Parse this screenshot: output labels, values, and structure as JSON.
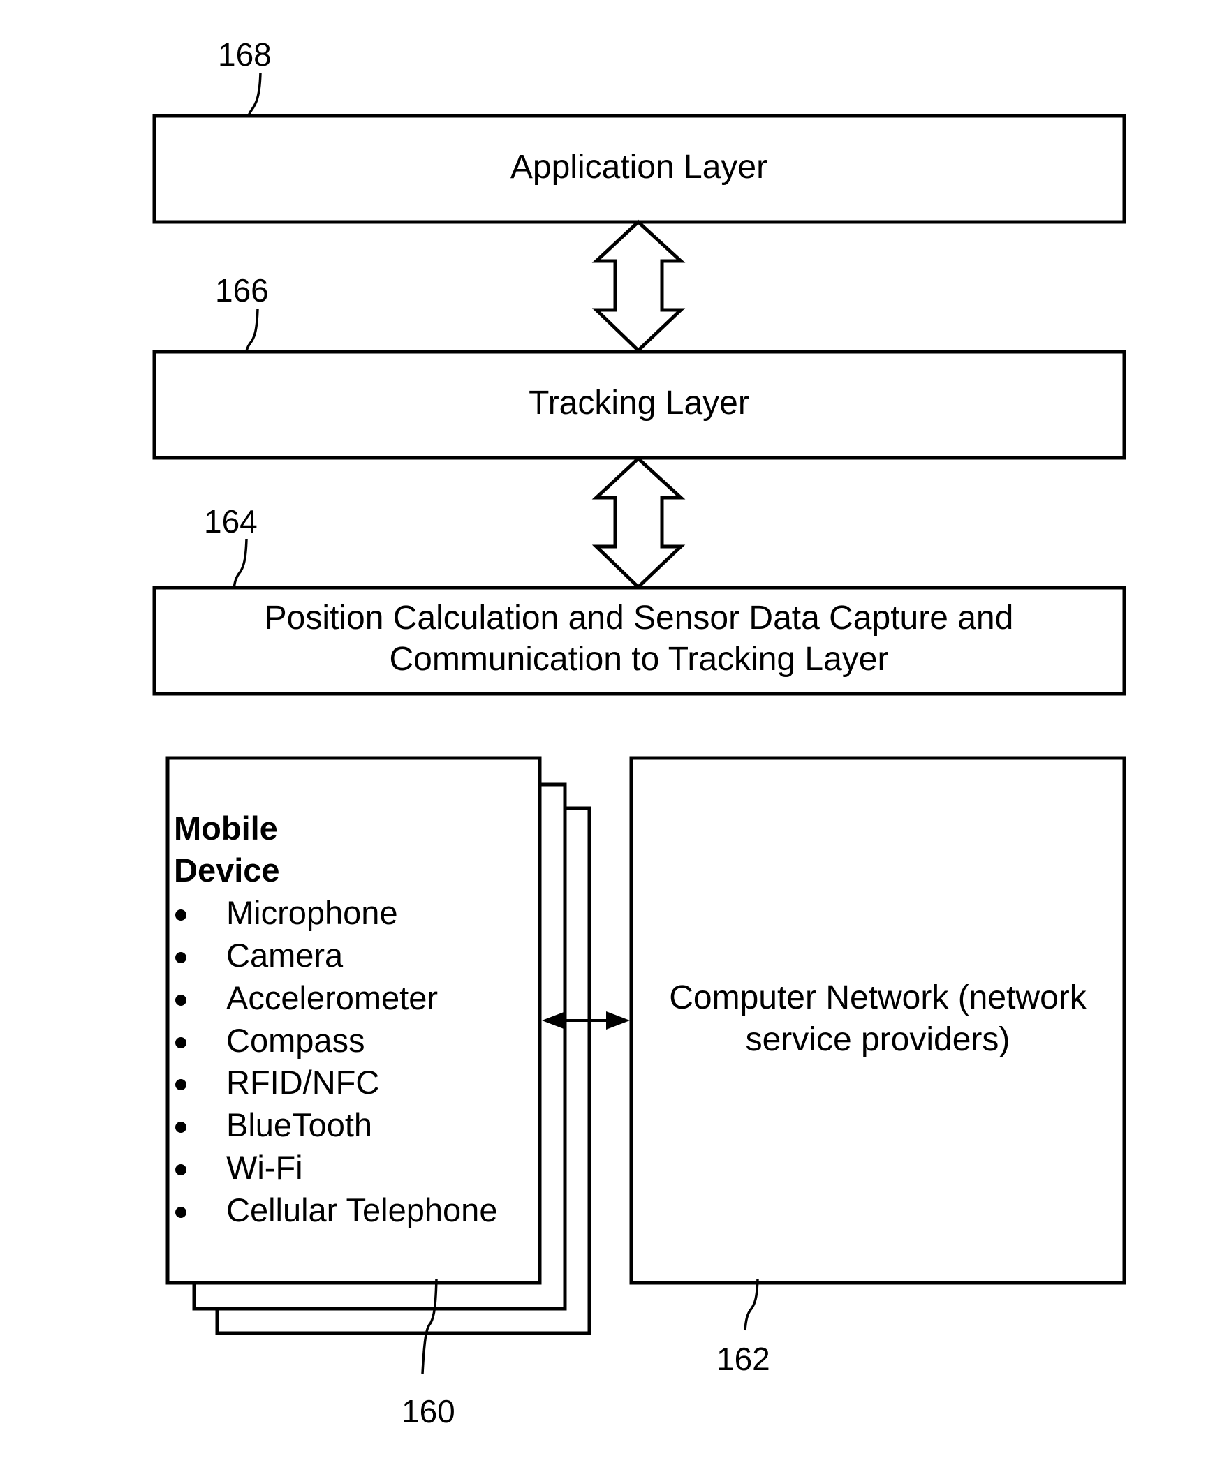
{
  "diagram": {
    "labels": {
      "application_ref": "168",
      "tracking_ref": "166",
      "position_ref": "164",
      "mobile_ref": "160",
      "network_ref": "162"
    },
    "layers": {
      "application": "Application Layer",
      "tracking": "Tracking Layer",
      "position_line1": "Position Calculation and Sensor Data Capture and",
      "position_line2": "Communication to Tracking Layer"
    },
    "mobile_device": {
      "title_line1": "Mobile",
      "title_line2": "Device",
      "bullet": "•",
      "items": [
        "Microphone",
        "Camera",
        "Accelerometer",
        "Compass",
        "RFID/NFC",
        "BlueTooth",
        "Wi-Fi",
        "Cellular Telephone"
      ]
    },
    "network": {
      "line1": "Computer Network (network",
      "line2": "service providers)"
    }
  }
}
